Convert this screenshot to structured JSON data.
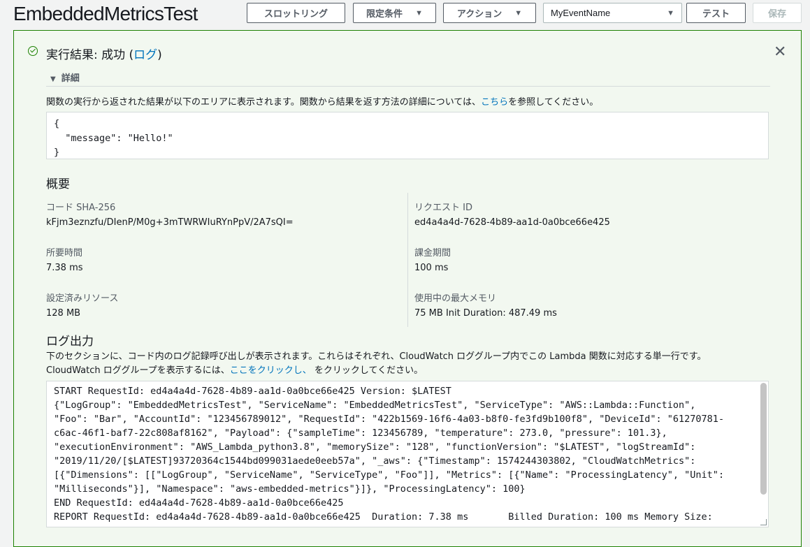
{
  "header": {
    "title": "EmbeddedMetricsTest",
    "throttling_label": "スロットリング",
    "qualifiers_label": "限定条件",
    "actions_label": "アクション",
    "event_select_value": "MyEventName",
    "test_label": "テスト",
    "save_label": "保存"
  },
  "result": {
    "title_prefix": "実行結果: 成功 (",
    "log_link": "ログ",
    "title_suffix": ")",
    "details_label": "詳細",
    "description_prefix": "関数の実行から返された結果が以下のエリアに表示されます。関数から結果を返す方法の詳細については、",
    "description_link": "こちら",
    "description_suffix": "を参照してください。",
    "output": "{\n  \"message\": \"Hello!\"\n}"
  },
  "summary": {
    "heading": "概要",
    "code_sha_label": "コード SHA-256",
    "code_sha_value": "kFjm3eznzfu/DIenP/M0g+3mTWRWIuRYnPpV/2A7sQI=",
    "request_id_label": "リクエスト ID",
    "request_id_value": "ed4a4a4d-7628-4b89-aa1d-0a0bce66e425",
    "duration_label": "所要時間",
    "duration_value": "7.38 ms",
    "billed_label": "課金期間",
    "billed_value": "100 ms",
    "resources_label": "設定済みリソース",
    "resources_value": "128 MB",
    "max_memory_label": "使用中の最大メモリ",
    "max_memory_value": "75 MB Init Duration: 487.49 ms"
  },
  "log": {
    "heading": "ログ出力",
    "description_line1": "下のセクションに、コード内のログ記録呼び出しが表示されます。これらはそれぞれ、CloudWatch ロググループ内でこの Lambda 関数に対応する単一行です。",
    "description_line2_prefix": "CloudWatch ロググループを表示するには、",
    "description_link": "ここをクリックし、",
    "description_line2_suffix": " をクリックしてください。",
    "lines": [
      "START RequestId: ed4a4a4d-7628-4b89-aa1d-0a0bce66e425 Version: $LATEST",
      "{\"LogGroup\": \"EmbeddedMetricsTest\", \"ServiceName\": \"EmbeddedMetricsTest\", \"ServiceType\": \"AWS::Lambda::Function\",",
      "\"Foo\": \"Bar\", \"AccountId\": \"123456789012\", \"RequestId\": \"422b1569-16f6-4a03-b8f0-fe3fd9b100f8\", \"DeviceId\": \"61270781-",
      "c6ac-46f1-baf7-22c808af8162\", \"Payload\": {\"sampleTime\": 123456789, \"temperature\": 273.0, \"pressure\": 101.3},",
      "\"executionEnvironment\": \"AWS_Lambda_python3.8\", \"memorySize\": \"128\", \"functionVersion\": \"$LATEST\", \"logStreamId\":",
      "\"2019/11/20/[$LATEST]93720364c1544bd099031aede0eeb57a\", \"_aws\": {\"Timestamp\": 1574244303802, \"CloudWatchMetrics\":",
      "[{\"Dimensions\": [[\"LogGroup\", \"ServiceName\", \"ServiceType\", \"Foo\"]], \"Metrics\": [{\"Name\": \"ProcessingLatency\", \"Unit\":",
      "\"Milliseconds\"}], \"Namespace\": \"aws-embedded-metrics\"}]}, \"ProcessingLatency\": 100}",
      "END RequestId: ed4a4a4d-7628-4b89-aa1d-0a0bce66e425",
      "REPORT RequestId: ed4a4a4d-7628-4b89-aa1d-0a0bce66e425  Duration: 7.38 ms       Billed Duration: 100 ms Memory Size:"
    ]
  },
  "colors": {
    "success": "#1d8102",
    "link": "#0073bb",
    "panel_bg": "#f2f8f0"
  },
  "icons": [
    "success-check-icon",
    "close-icon",
    "caret-down-icon",
    "details-toggle-icon"
  ]
}
